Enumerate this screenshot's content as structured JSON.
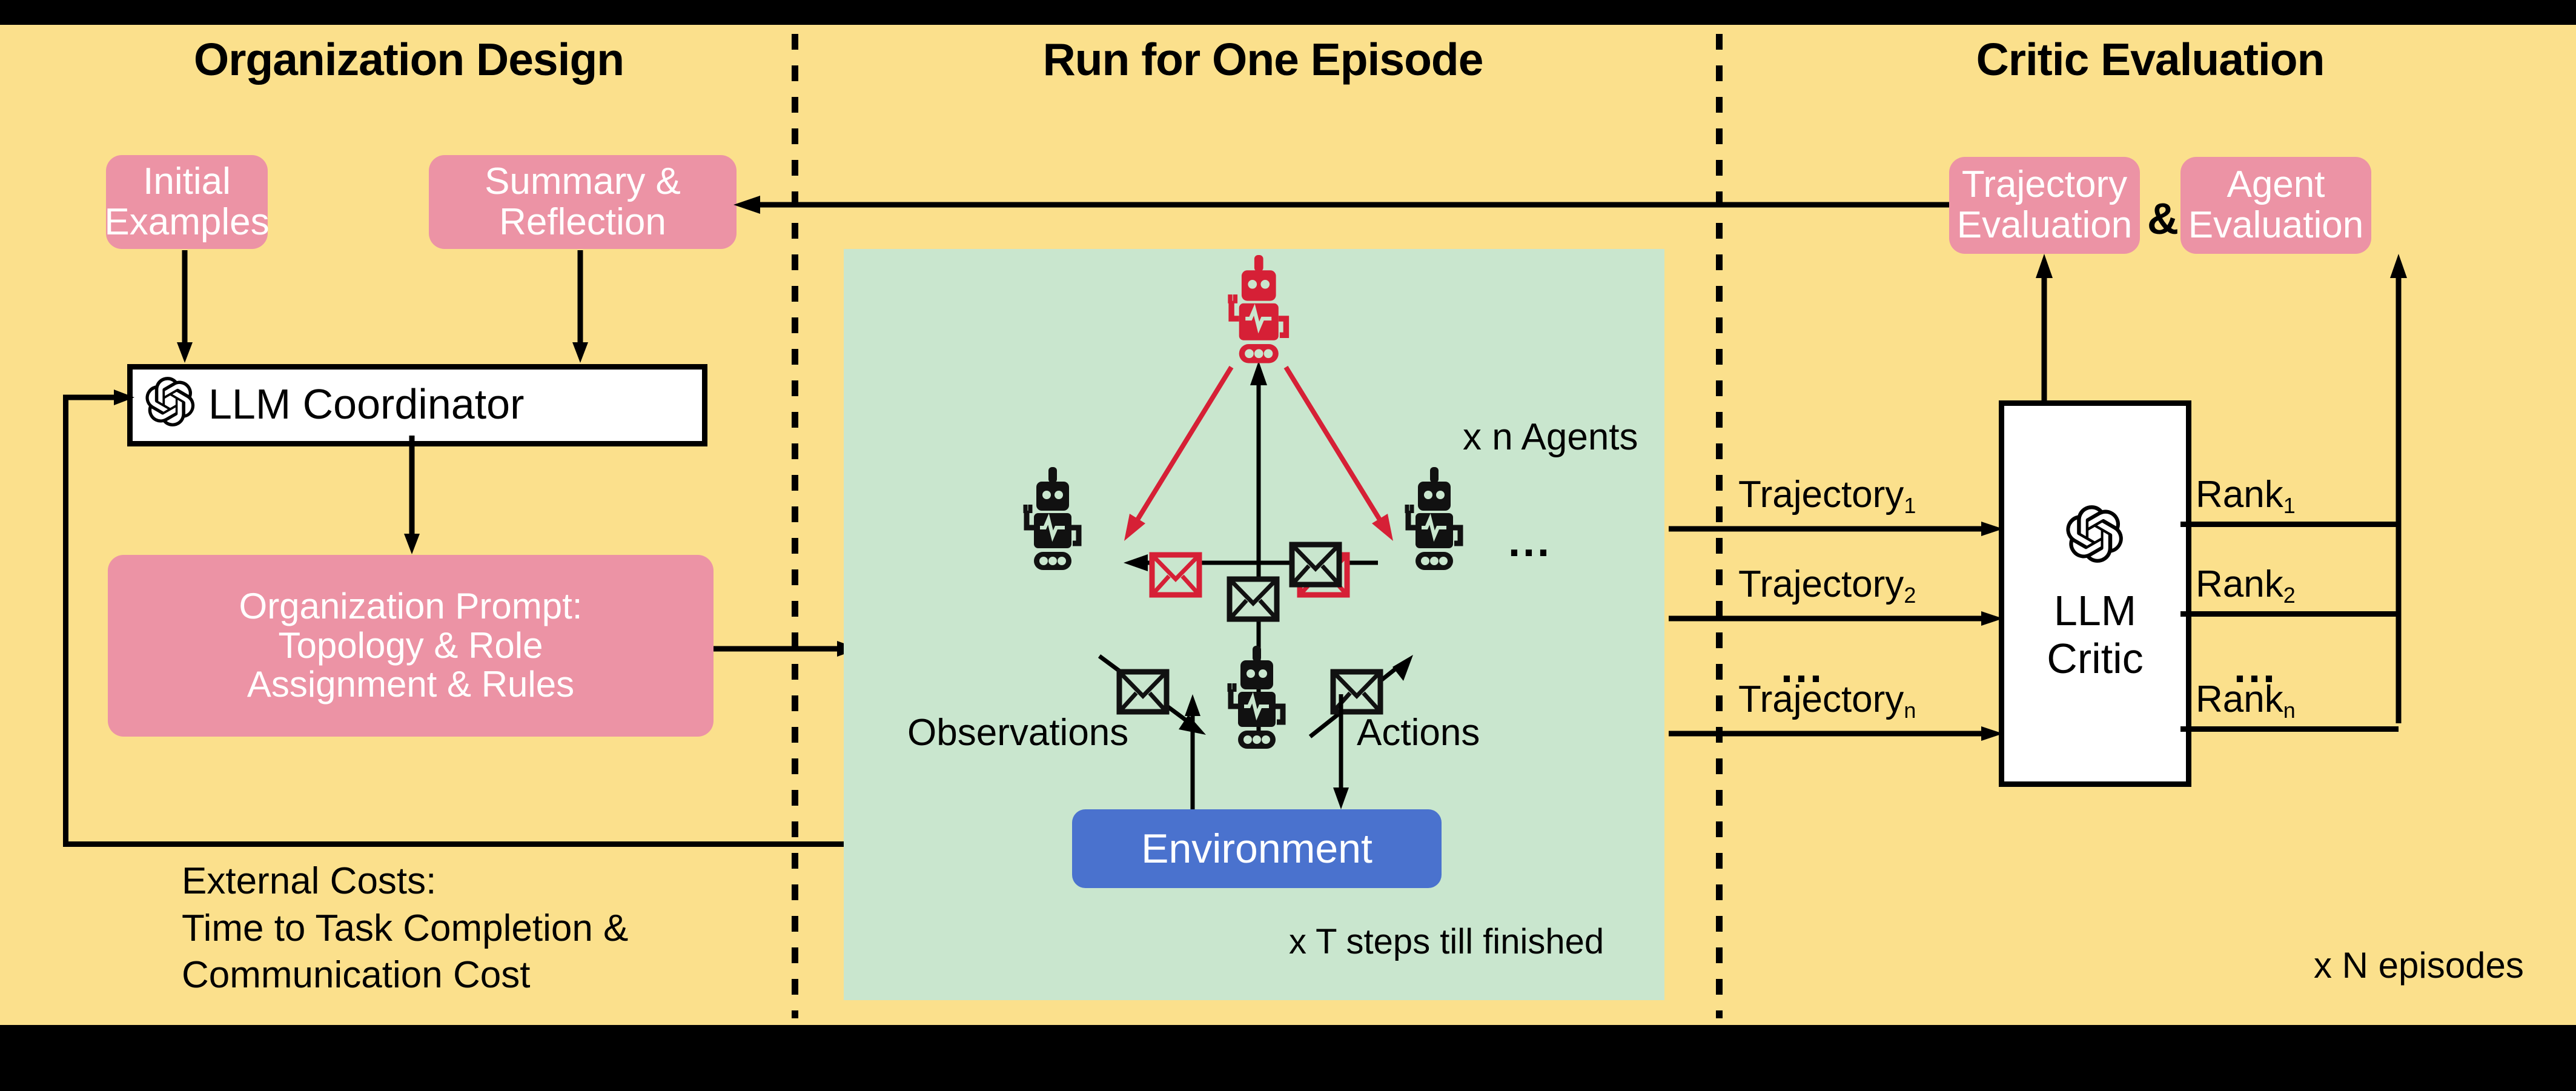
{
  "sections": {
    "left_title": "Organization Design",
    "middle_title": "Run for One Episode",
    "right_title": "Critic Evaluation"
  },
  "left": {
    "initial_examples": "Initial\nExamples",
    "summary_reflection": "Summary &\nReflection",
    "coordinator_label": "LLM Coordinator",
    "coordinator_icon": "openai-logo-icon",
    "org_prompt": "Organization Prompt:\nTopology & Role\nAssignment & Rules",
    "external_costs": "External Costs:\nTime to Task Completion &\nCommunication Cost"
  },
  "middle": {
    "agents_note": "x n Agents",
    "ellipsis": "...",
    "observations_label": "Observations",
    "actions_label": "Actions",
    "environment_label": "Environment",
    "steps_note": "x T steps till finished",
    "agents": [
      {
        "id": "leader-agent",
        "color": "#d62036",
        "role": "leader"
      },
      {
        "id": "agent-left",
        "color": "#111111",
        "role": "worker"
      },
      {
        "id": "agent-right",
        "color": "#111111",
        "role": "worker"
      },
      {
        "id": "agent-bottom",
        "color": "#111111",
        "role": "worker"
      }
    ],
    "messages": [
      {
        "id": "msg-red-left",
        "color": "#d62036"
      },
      {
        "id": "msg-red-right",
        "color": "#d62036"
      },
      {
        "id": "msg-black-top",
        "color": "#111111"
      },
      {
        "id": "msg-black-mid",
        "color": "#111111"
      },
      {
        "id": "msg-black-bl",
        "color": "#111111"
      },
      {
        "id": "msg-black-br",
        "color": "#111111"
      }
    ]
  },
  "right": {
    "trajectory_evaluation": "Trajectory\nEvaluation",
    "ampersand": "&",
    "agent_evaluation": "Agent\nEvaluation",
    "critic_icon": "openai-logo-icon",
    "critic_label": "LLM\nCritic",
    "trajectories": [
      "Trajectory",
      "Trajectory",
      "Trajectory"
    ],
    "trajectory_subs": [
      "1",
      "2",
      "n"
    ],
    "trajectory_ellipsis": "...",
    "ranks": [
      "Rank",
      "Rank",
      "Rank"
    ],
    "rank_subs": [
      "1",
      "2",
      "n"
    ],
    "rank_ellipsis": "...",
    "episodes_note": "x N episodes"
  },
  "colors": {
    "background": "#fbe08c",
    "pink": "#ec93a5",
    "green": "#c9e6ce",
    "blue": "#4a72ce",
    "red": "#d62036",
    "black": "#000000",
    "white": "#ffffff"
  }
}
